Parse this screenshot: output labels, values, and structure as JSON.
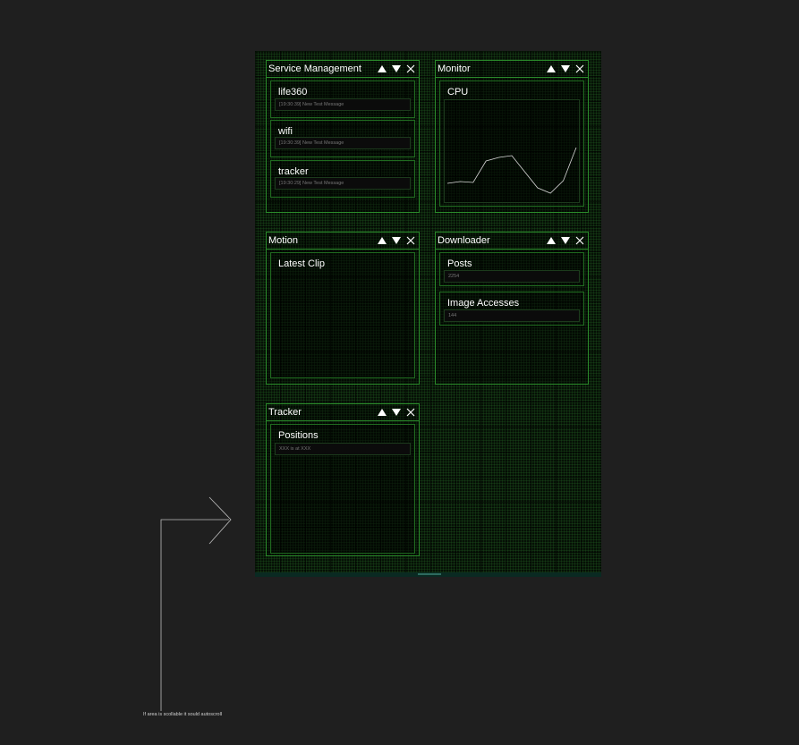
{
  "service_management": {
    "title": "Service Management",
    "services": [
      {
        "name": "life360",
        "message": "[19:30:39] New Test Message"
      },
      {
        "name": "wifi",
        "message": "[19:30:39] New Test Message"
      },
      {
        "name": "tracker",
        "message": "[19:30:29] New Test Message"
      }
    ]
  },
  "monitor": {
    "title": "Monitor",
    "cpu_label": "CPU"
  },
  "motion": {
    "title": "Motion",
    "latest_clip_label": "Latest Clip"
  },
  "downloader": {
    "title": "Downloader",
    "posts_label": "Posts",
    "posts_value": "2254",
    "image_accesses_label": "Image Accesses",
    "image_accesses_value": "144"
  },
  "tracker": {
    "title": "Tracker",
    "positions_label": "Positions",
    "positions_value": "XXX is at XXX"
  },
  "annotation": {
    "note": "If area is scollable it sould autoscroll"
  },
  "colors": {
    "panel_border": "#2a8a2a",
    "background": "#1f1f1f",
    "text": "#ffffff"
  },
  "icons": [
    "move-up-icon",
    "move-down-icon",
    "close-icon"
  ],
  "chart_data": {
    "type": "line",
    "title": "CPU",
    "series": [
      {
        "values": [
          0.15,
          0.17,
          0.16,
          0.4,
          0.44,
          0.46,
          0.28,
          0.1,
          0.04,
          0.18,
          0.55
        ]
      }
    ]
  }
}
